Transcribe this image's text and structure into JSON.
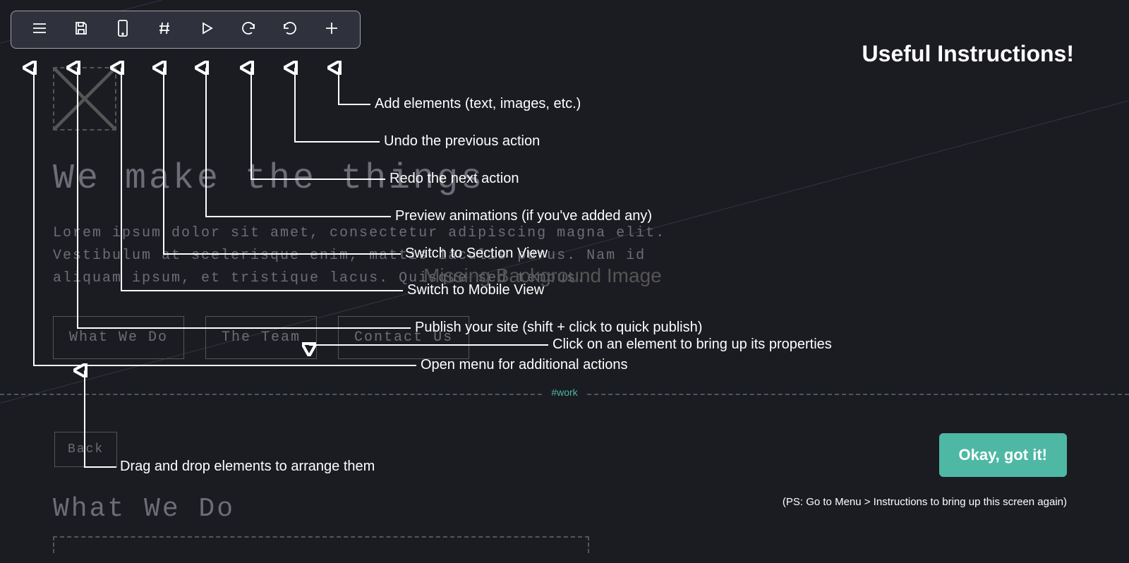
{
  "toolbar": {
    "items": [
      {
        "name": "menu",
        "icon": "menu-icon"
      },
      {
        "name": "publish",
        "icon": "save-icon"
      },
      {
        "name": "mobile",
        "icon": "mobile-icon"
      },
      {
        "name": "sections",
        "icon": "hash-icon"
      },
      {
        "name": "preview",
        "icon": "play-icon"
      },
      {
        "name": "redo",
        "icon": "redo-icon"
      },
      {
        "name": "undo",
        "icon": "undo-icon"
      },
      {
        "name": "add",
        "icon": "plus-icon"
      }
    ]
  },
  "canvas": {
    "hero_title": "We make the things",
    "hero_para": "Lorem ipsum dolor sit amet, consectetur adipiscing magna elit.\nVestibulum at scelerisque enim, mattis iaculis purus. Nam id\naliquam ipsum, et tristique lacus. Quisque sed tempus.",
    "nav_buttons": [
      "What We Do",
      "The Team",
      "Contact Us"
    ],
    "missing_bg": "Missing Background Image",
    "section_anchor": "#work",
    "back_label": "Back",
    "sub_title": "What We Do"
  },
  "instructions": {
    "title": "Useful Instructions!",
    "labels": {
      "add": "Add elements (text, images, etc.)",
      "undo": "Undo the previous action",
      "redo": "Redo the next action",
      "preview": "Preview animations (if you've added any)",
      "sections": "Switch to Section View",
      "mobile": "Switch to Mobile View",
      "publish": "Publish your site (shift + click to quick publish)",
      "click": "Click on an element to bring up its properties",
      "menu": "Open menu for additional actions",
      "drag": "Drag and drop elements to arrange them"
    },
    "ok_button": "Okay, got it!",
    "ps_note": "(PS: Go to Menu > Instructions to bring up this screen again)"
  }
}
